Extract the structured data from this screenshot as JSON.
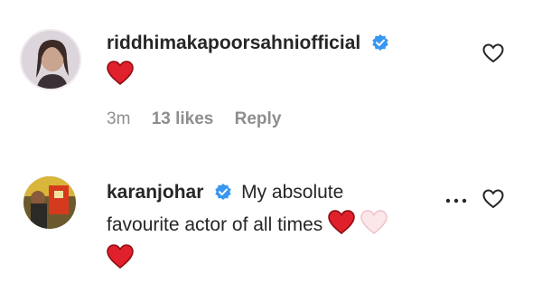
{
  "comments": [
    {
      "username": "riddhimakapoorsahniofficial",
      "verified": true,
      "text": "",
      "time": "3m",
      "likes": "13 likes",
      "reply_label": "Reply"
    },
    {
      "username": "karanjohar",
      "verified": true,
      "text_line1": "My absolute",
      "text_line2": "favourite actor of all times"
    }
  ],
  "colors": {
    "verified_blue": "#3897f0",
    "heart_red": "#e0202a",
    "heart_pink": "#f7d4d8",
    "meta_gray": "#8e8e8e"
  },
  "icons": [
    "verified-badge-icon",
    "heart-outline-icon",
    "red-heart-emoji",
    "white-heart-emoji",
    "more-options-icon"
  ]
}
